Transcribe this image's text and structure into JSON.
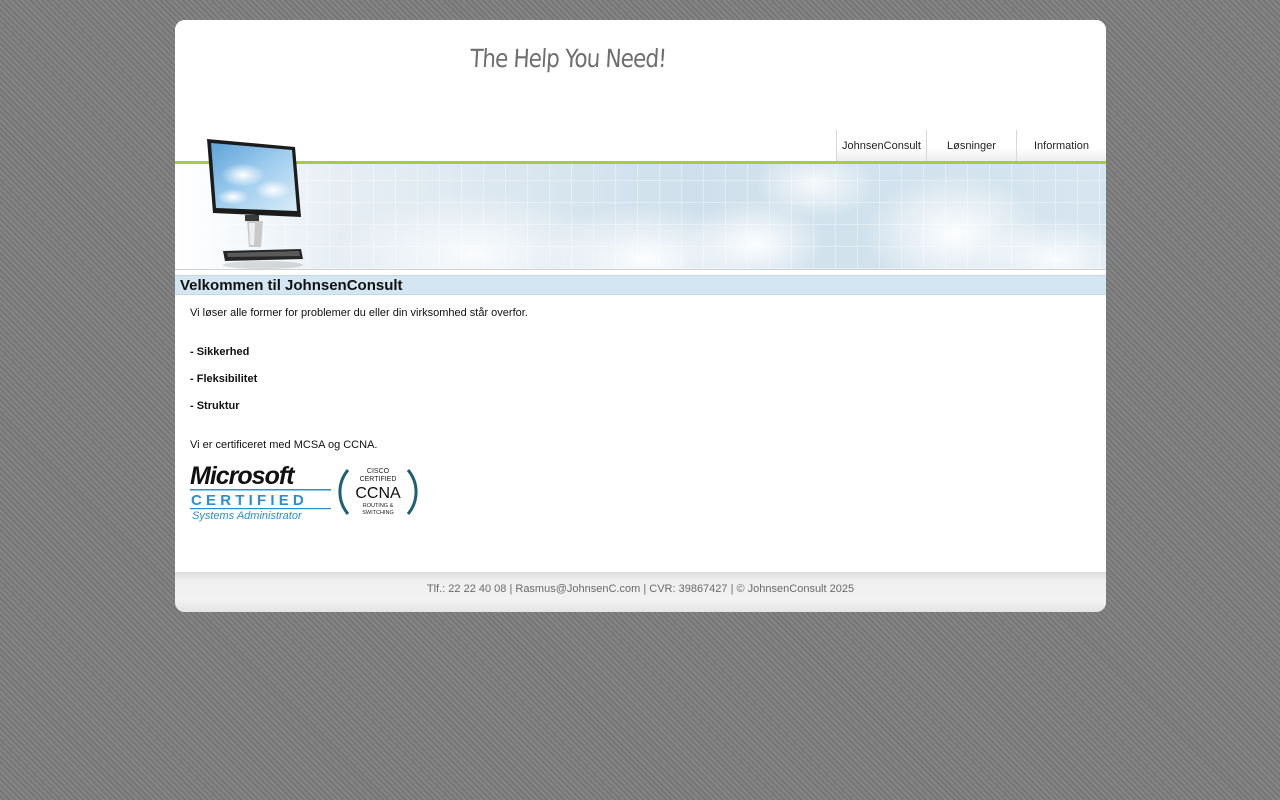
{
  "header": {
    "tagline": "The Help You Need!"
  },
  "nav": {
    "items": [
      {
        "label": "JohnsenConsult"
      },
      {
        "label": "Løsninger"
      },
      {
        "label": "Information"
      }
    ]
  },
  "main": {
    "title": "Velkommen til JohnsenConsult",
    "intro": "Vi løser alle former for problemer du eller din virksomhed står overfor.",
    "features": [
      "- Sikkerhed",
      "- Fleksibilitet",
      "- Struktur"
    ],
    "cert_text": "Vi er certificeret med MCSA og CCNA.",
    "logos": {
      "microsoft": {
        "brand": "Microsoft",
        "certified": "CERTIFIED",
        "role": "Systems Administrator"
      },
      "cisco": {
        "cisco": "CISCO",
        "certified": "CERTIFIED",
        "name": "CCNA",
        "track_line1": "ROUTING &",
        "track_line2": "SWITCHING"
      }
    }
  },
  "footer": {
    "phone": "Tlf.: 22 22 40 08",
    "email": "Rasmus@JohnsenC.com",
    "cvr": "CVR: 39867427",
    "copyright": "© JohnsenConsult 2025",
    "separator": "|"
  },
  "colors": {
    "accent_green": "#a6cc46",
    "title_bar": "#d4e6f2",
    "microsoft_blue": "#2a8fd0",
    "cisco_teal": "#1d5e78"
  }
}
